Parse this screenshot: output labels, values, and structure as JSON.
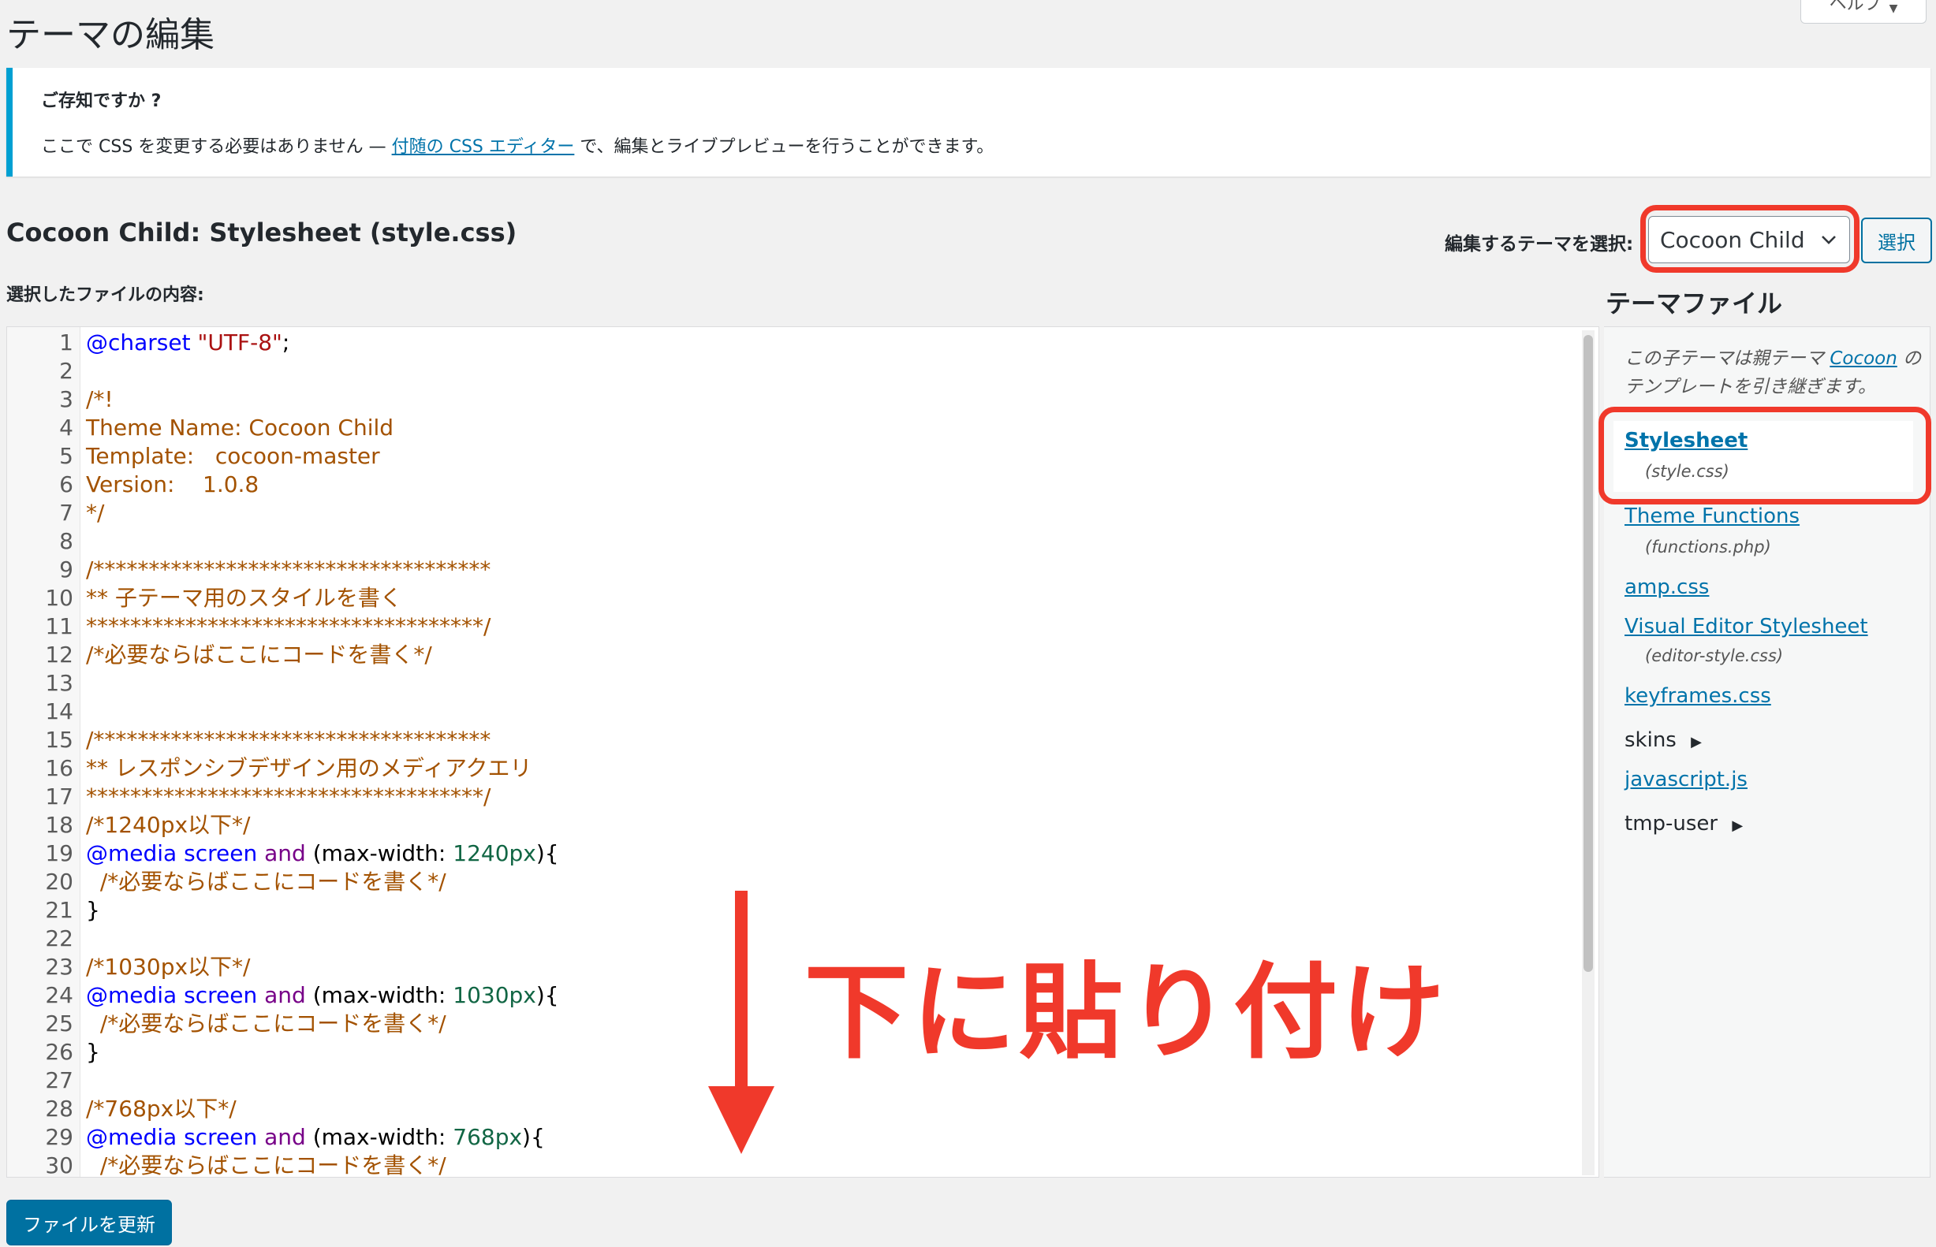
{
  "page": {
    "title": "テーマの編集",
    "help_tab": "ヘルプ"
  },
  "notice": {
    "title": "ご存知ですか ?",
    "text_before": "ここで CSS を変更する必要はありません — ",
    "link": "付随の CSS エディター",
    "text_after": " で、編集とライブプレビューを行うことができます。"
  },
  "editor": {
    "file_heading": "Cocoon Child: Stylesheet (style.css)",
    "select_label": "編集するテーマを選択:",
    "selected_theme": "Cocoon Child",
    "select_button": "選択",
    "content_label": "選択したファイルの内容:",
    "update_button": "ファイルを更新"
  },
  "code_lines": [
    {
      "n": "1",
      "parts": [
        [
          "at",
          "@charset"
        ],
        [
          "plain",
          " "
        ],
        [
          "str",
          "\"UTF-8\""
        ],
        [
          "plain",
          ";"
        ]
      ]
    },
    {
      "n": "2",
      "parts": []
    },
    {
      "n": "3",
      "parts": [
        [
          "com",
          "/*!"
        ]
      ]
    },
    {
      "n": "4",
      "parts": [
        [
          "com",
          "Theme Name: Cocoon Child"
        ]
      ]
    },
    {
      "n": "5",
      "parts": [
        [
          "com",
          "Template:   cocoon-master"
        ]
      ]
    },
    {
      "n": "6",
      "parts": [
        [
          "com",
          "Version:    1.0.8"
        ]
      ]
    },
    {
      "n": "7",
      "parts": [
        [
          "com",
          "*/"
        ]
      ]
    },
    {
      "n": "8",
      "parts": []
    },
    {
      "n": "9",
      "parts": [
        [
          "com",
          "/************************************"
        ]
      ]
    },
    {
      "n": "10",
      "parts": [
        [
          "com",
          "** 子テーマ用のスタイルを書く"
        ]
      ]
    },
    {
      "n": "11",
      "parts": [
        [
          "com",
          "************************************/"
        ]
      ]
    },
    {
      "n": "12",
      "parts": [
        [
          "com",
          "/*必要ならばここにコードを書く*/"
        ]
      ]
    },
    {
      "n": "13",
      "parts": []
    },
    {
      "n": "14",
      "parts": []
    },
    {
      "n": "15",
      "parts": [
        [
          "com",
          "/************************************"
        ]
      ]
    },
    {
      "n": "16",
      "parts": [
        [
          "com",
          "** レスポンシブデザイン用のメディアクエリ"
        ]
      ]
    },
    {
      "n": "17",
      "parts": [
        [
          "com",
          "************************************/"
        ]
      ]
    },
    {
      "n": "18",
      "parts": [
        [
          "com",
          "/*1240px以下*/"
        ]
      ]
    },
    {
      "n": "19",
      "parts": [
        [
          "at",
          "@media"
        ],
        [
          "plain",
          " "
        ],
        [
          "at",
          "screen"
        ],
        [
          "plain",
          " "
        ],
        [
          "kw",
          "and"
        ],
        [
          "plain",
          " (max-width: "
        ],
        [
          "num",
          "1240px"
        ],
        [
          "plain",
          "){"
        ]
      ]
    },
    {
      "n": "20",
      "parts": [
        [
          "plain",
          "  "
        ],
        [
          "com",
          "/*必要ならばここにコードを書く*/"
        ]
      ]
    },
    {
      "n": "21",
      "parts": [
        [
          "plain",
          "}"
        ]
      ]
    },
    {
      "n": "22",
      "parts": []
    },
    {
      "n": "23",
      "parts": [
        [
          "com",
          "/*1030px以下*/"
        ]
      ]
    },
    {
      "n": "24",
      "parts": [
        [
          "at",
          "@media"
        ],
        [
          "plain",
          " "
        ],
        [
          "at",
          "screen"
        ],
        [
          "plain",
          " "
        ],
        [
          "kw",
          "and"
        ],
        [
          "plain",
          " (max-width: "
        ],
        [
          "num",
          "1030px"
        ],
        [
          "plain",
          "){"
        ]
      ]
    },
    {
      "n": "25",
      "parts": [
        [
          "plain",
          "  "
        ],
        [
          "com",
          "/*必要ならばここにコードを書く*/"
        ]
      ]
    },
    {
      "n": "26",
      "parts": [
        [
          "plain",
          "}"
        ]
      ]
    },
    {
      "n": "27",
      "parts": []
    },
    {
      "n": "28",
      "parts": [
        [
          "com",
          "/*768px以下*/"
        ]
      ]
    },
    {
      "n": "29",
      "parts": [
        [
          "at",
          "@media"
        ],
        [
          "plain",
          " "
        ],
        [
          "at",
          "screen"
        ],
        [
          "plain",
          " "
        ],
        [
          "kw",
          "and"
        ],
        [
          "plain",
          " (max-width: "
        ],
        [
          "num",
          "768px"
        ],
        [
          "plain",
          "){"
        ]
      ]
    },
    {
      "n": "30",
      "parts": [
        [
          "plain",
          "  "
        ],
        [
          "com",
          "/*必要ならばここにコードを書く*/"
        ]
      ]
    }
  ],
  "theme_files": {
    "heading": "テーマファイル",
    "parent_note_before": "この子テーマは親テーマ ",
    "parent_link": "Cocoon",
    "parent_note_after": " のテンプレートを引き継ぎます。",
    "stylesheet": {
      "label": "Stylesheet",
      "file": "(style.css)"
    },
    "functions": {
      "label": "Theme Functions",
      "file": "(functions.php)"
    },
    "amp": {
      "label": "amp.css"
    },
    "visual_editor": {
      "label": "Visual Editor Stylesheet",
      "file": "(editor-style.css)"
    },
    "keyframes": {
      "label": "keyframes.css"
    },
    "skins": {
      "label": "skins"
    },
    "javascript": {
      "label": "javascript.js"
    },
    "tmp_user": {
      "label": "tmp-user"
    }
  },
  "annotation": {
    "text": "下に貼り付け",
    "color": "#f0392b"
  },
  "icons": {
    "chevron": "chevron-down-icon",
    "expand": "triangle-right-icon",
    "arrow": "arrow-down-icon"
  }
}
